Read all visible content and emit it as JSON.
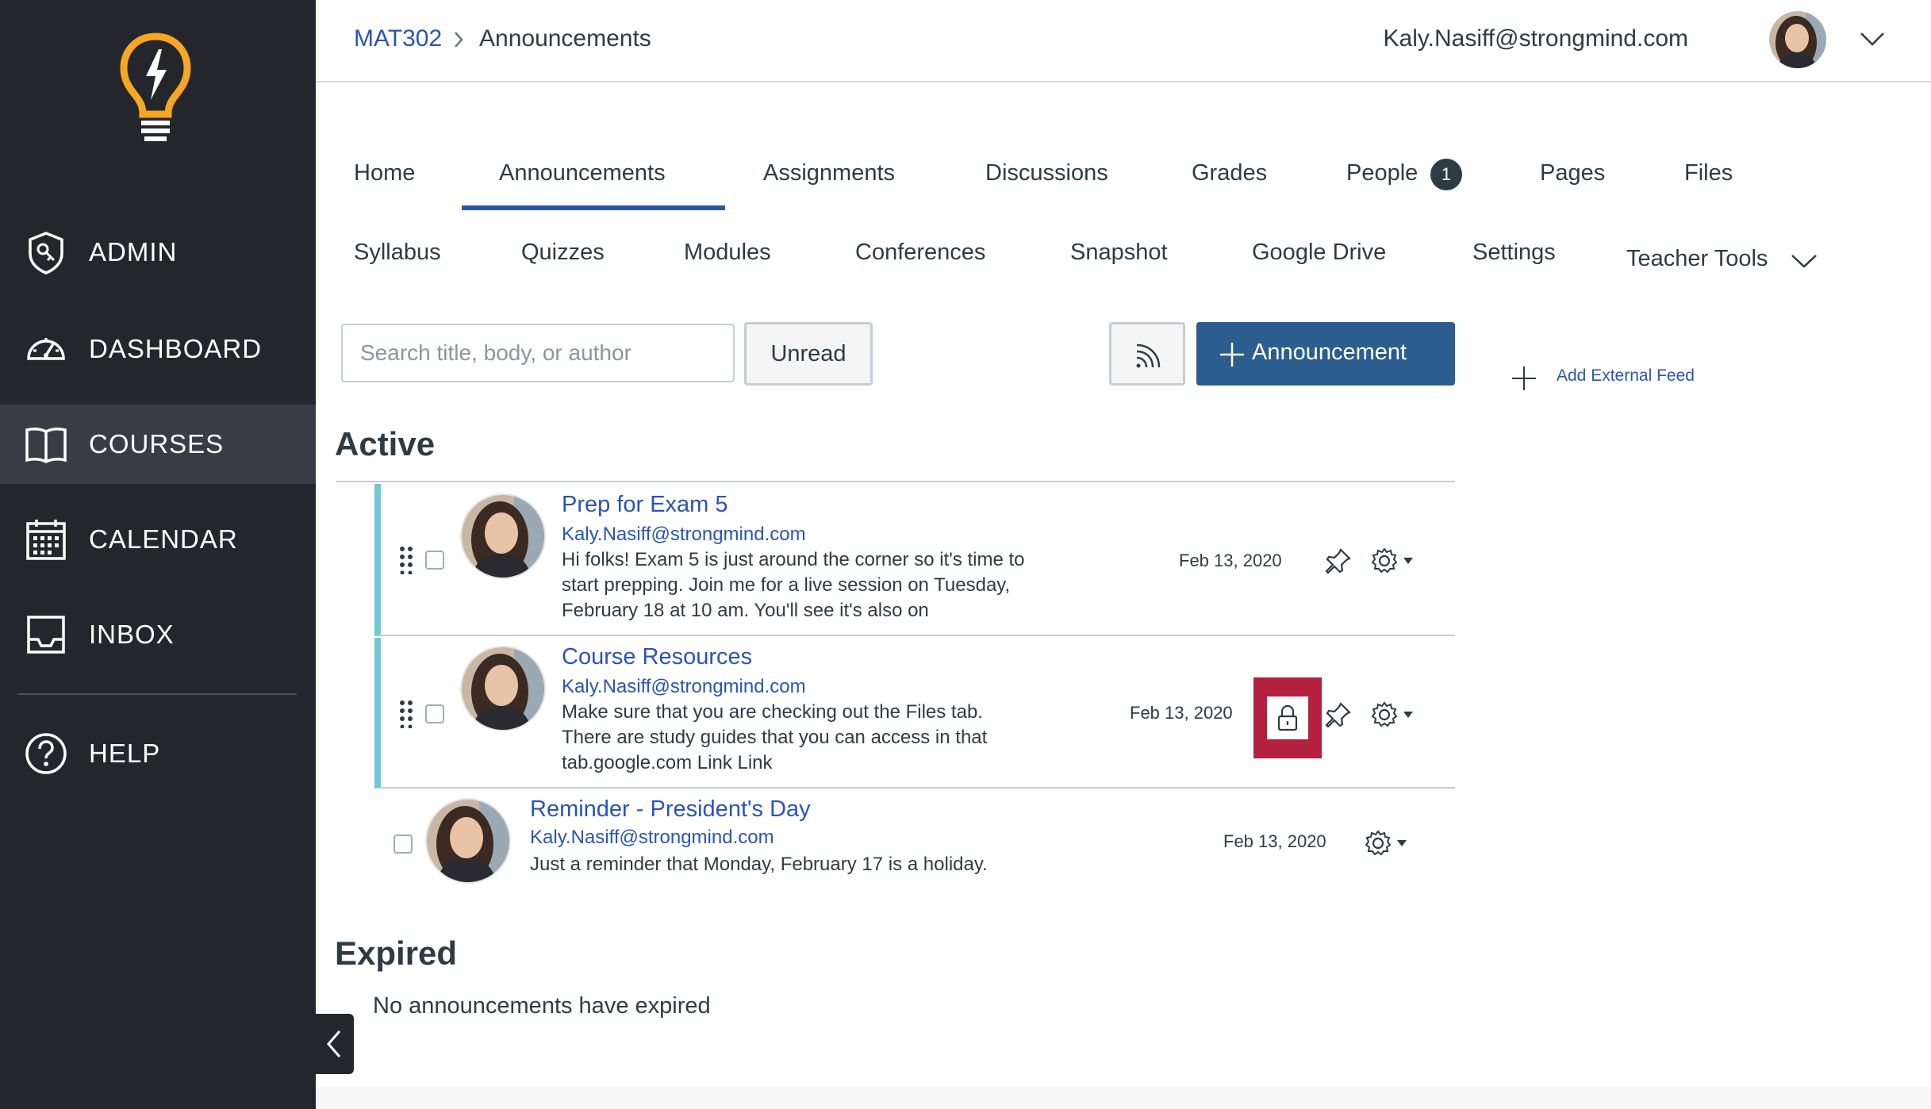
{
  "sidebar": {
    "items": [
      {
        "label": "ADMIN",
        "icon": "admin-shield-icon"
      },
      {
        "label": "DASHBOARD",
        "icon": "dashboard-gauge-icon"
      },
      {
        "label": "COURSES",
        "icon": "book-icon"
      },
      {
        "label": "CALENDAR",
        "icon": "calendar-icon"
      },
      {
        "label": "INBOX",
        "icon": "inbox-icon"
      },
      {
        "label": "HELP",
        "icon": "help-circle-icon"
      }
    ],
    "active": "COURSES",
    "logo_icon": "lightbulb-logo-icon"
  },
  "header": {
    "breadcrumb": {
      "course": "MAT302",
      "page": "Announcements"
    },
    "user_email": "Kaly.Nasiff@strongmind.com"
  },
  "tabs": {
    "row1": [
      "Home",
      "Announcements",
      "Assignments",
      "Discussions",
      "Grades",
      "People",
      "Pages",
      "Files"
    ],
    "row2": [
      "Syllabus",
      "Quizzes",
      "Modules",
      "Conferences",
      "Snapshot",
      "Google Drive",
      "Settings"
    ],
    "teacher_tools": "Teacher Tools",
    "active": "Announcements",
    "people_badge": "1"
  },
  "toolbar": {
    "search_placeholder": "Search title, body, or author",
    "unread_label": "Unread",
    "new_announcement_label": "Announcement",
    "add_external_feed_label": "Add External Feed"
  },
  "sections": {
    "active_title": "Active",
    "expired_title": "Expired",
    "expired_empty": "No announcements have expired"
  },
  "announcements": [
    {
      "title": "Prep for Exam 5",
      "author": "Kaly.Nasiff@strongmind.com",
      "body": "Hi folks! Exam 5 is just around the corner so it's time to start prepping. Join me for a live session on Tuesday, February 18 at 10 am. You'll see it's also on",
      "date": "Feb 13, 2020",
      "pinned": true,
      "locked": false
    },
    {
      "title": "Course Resources",
      "author": "Kaly.Nasiff@strongmind.com",
      "body": "Make sure that you are checking out the Files tab. There are study guides that you can access in that tab.google.com Link Link",
      "date": "Feb 13, 2020",
      "pinned": true,
      "locked": true
    },
    {
      "title": "Reminder - President's Day",
      "author": "Kaly.Nasiff@strongmind.com",
      "body": "Just a reminder that Monday, February 17 is a holiday.",
      "date": "Feb 13, 2020",
      "pinned": false,
      "locked": false
    }
  ],
  "colors": {
    "sidebar_bg": "#24262b",
    "sidebar_active": "#393c43",
    "link": "#2b54b4",
    "primary_button": "#2b5e8f",
    "pinned_border": "#6ecbd2",
    "lock_highlight": "#b3213f",
    "logo_yellow": "#f5a623"
  }
}
